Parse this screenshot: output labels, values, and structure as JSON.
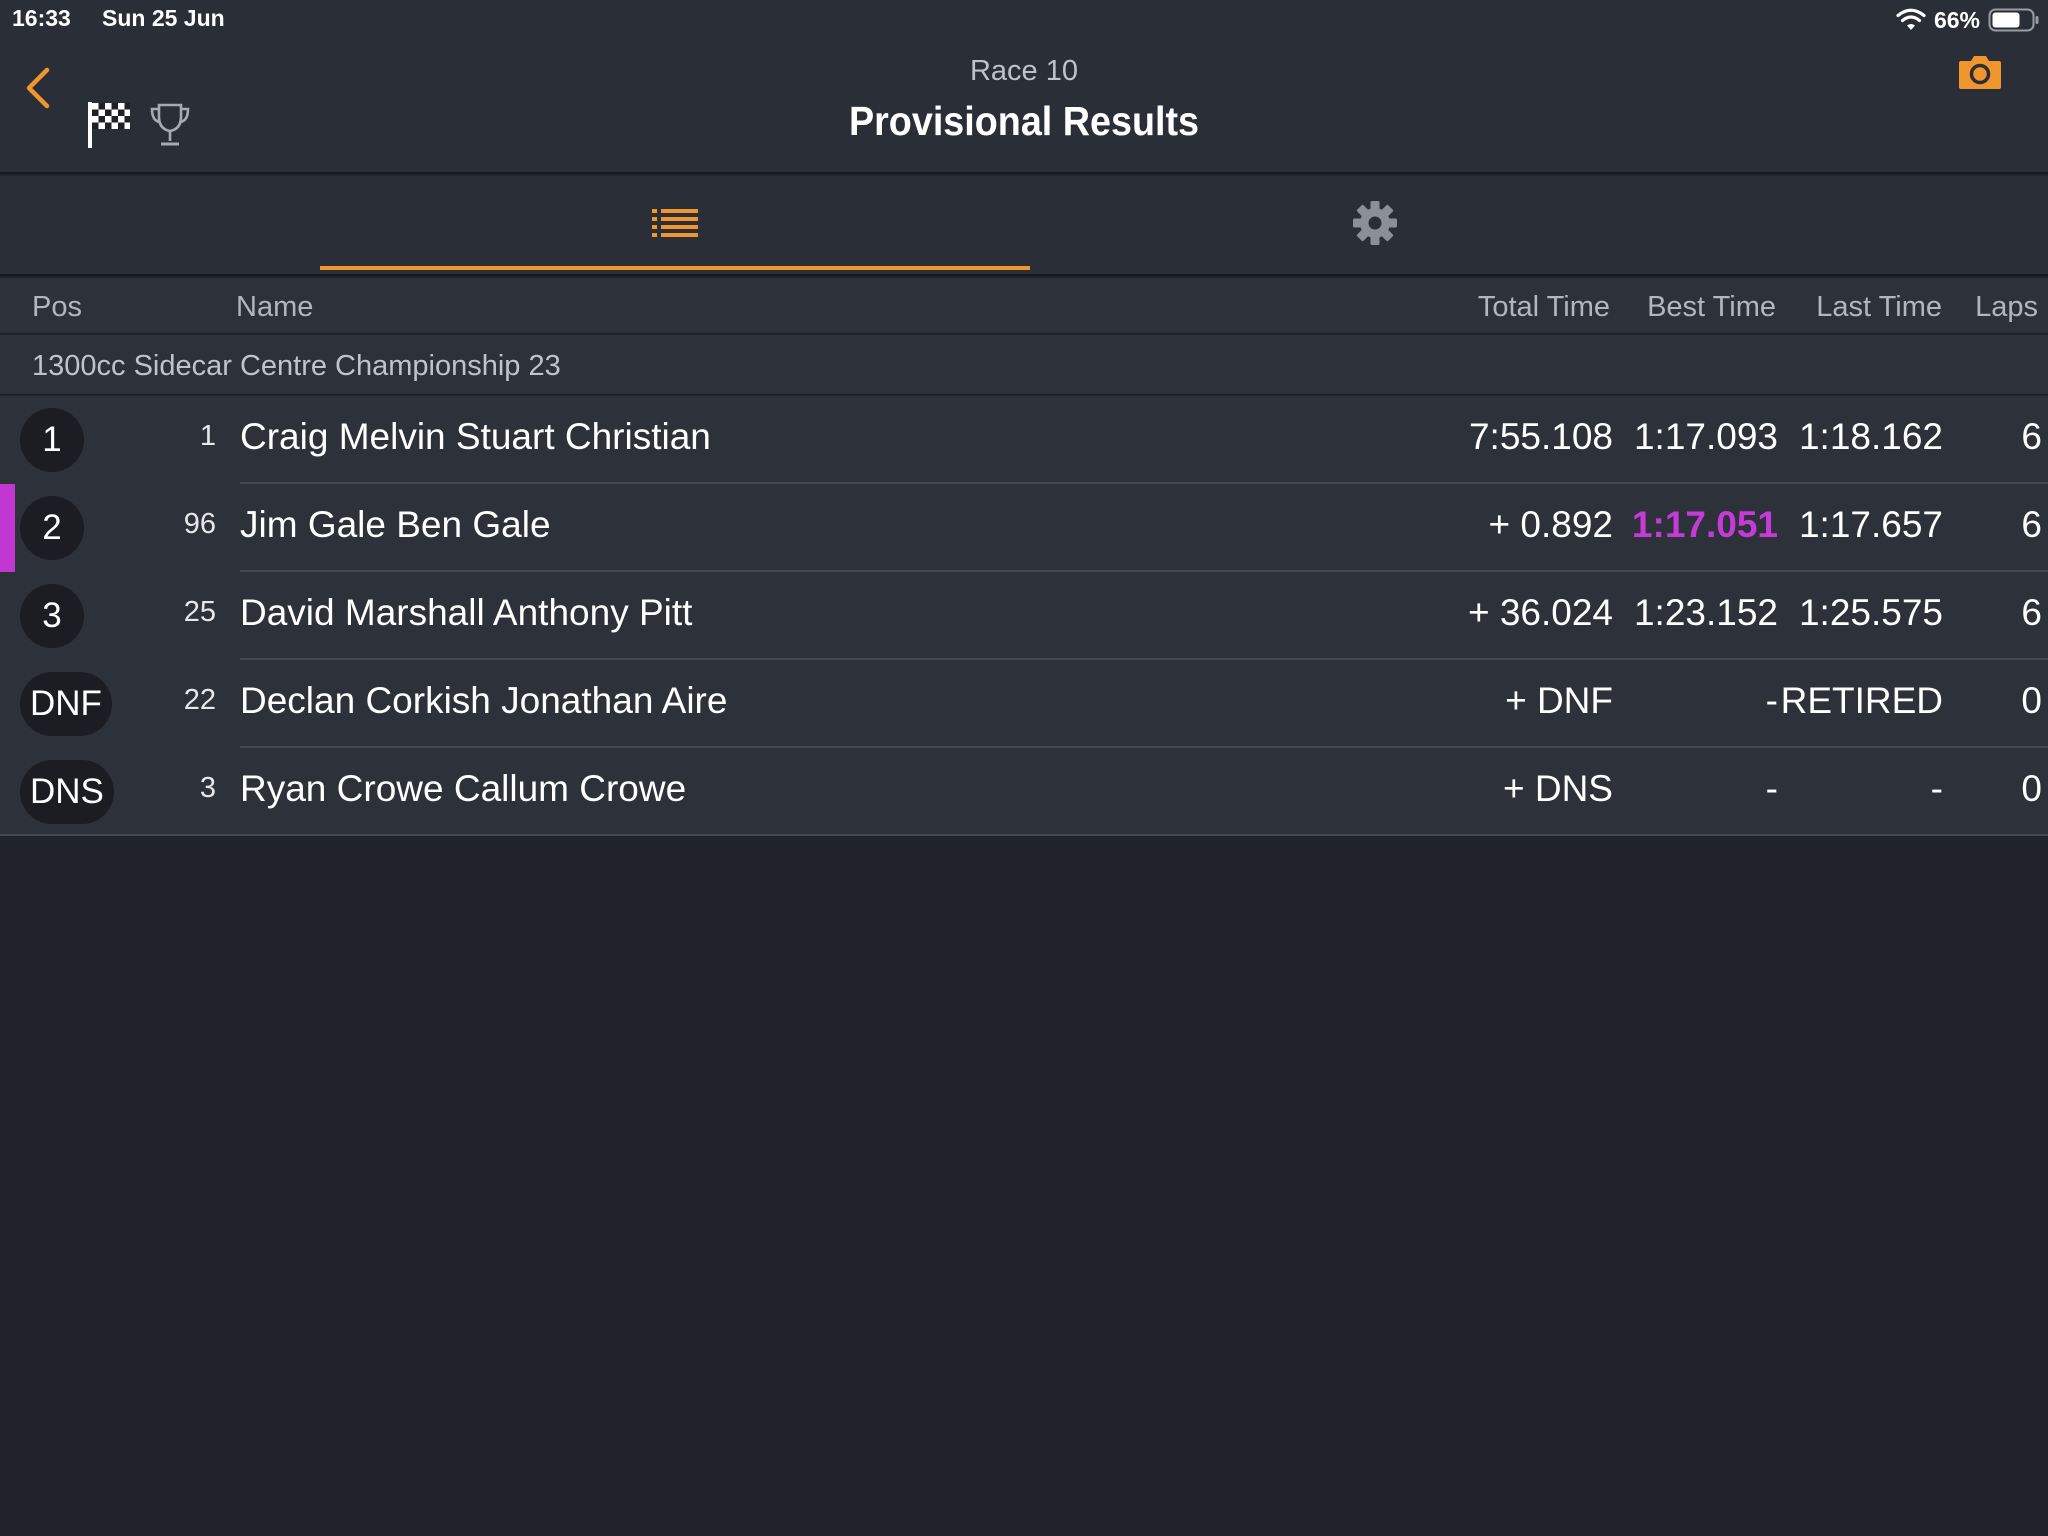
{
  "status_bar": {
    "time": "16:33",
    "date": "Sun 25 Jun",
    "battery_percent": "66%"
  },
  "header": {
    "subtitle": "Race 10",
    "title": "Provisional Results"
  },
  "tabs": [
    {
      "icon": "list-icon",
      "active": true
    },
    {
      "icon": "gear-icon",
      "active": false
    }
  ],
  "columns": {
    "pos": "Pos",
    "name": "Name",
    "total_time": "Total Time",
    "best_time": "Best Time",
    "last_time": "Last Time",
    "laps": "Laps"
  },
  "group": {
    "label": "1300cc Sidecar Centre Championship 23"
  },
  "results": [
    {
      "pos": "1",
      "number": "1",
      "name": "Craig Melvin Stuart Christian",
      "total_time": "7:55.108",
      "best_time": "1:17.093",
      "last_time": "1:18.162",
      "laps": "6"
    },
    {
      "pos": "2",
      "number": "96",
      "name": "Jim Gale Ben Gale",
      "total_time": "+ 0.892",
      "best_time": "1:17.051",
      "last_time": "1:17.657",
      "laps": "6"
    },
    {
      "pos": "3",
      "number": "25",
      "name": "David Marshall Anthony Pitt",
      "total_time": "+ 36.024",
      "best_time": "1:23.152",
      "last_time": "1:25.575",
      "laps": "6"
    },
    {
      "pos": "DNF",
      "number": "22",
      "name": "Declan Corkish Jonathan Aire",
      "total_time": "+ DNF",
      "best_time": "-",
      "last_time": "RETIRED",
      "laps": "0"
    },
    {
      "pos": "DNS",
      "number": "3",
      "name": "Ryan Crowe Callum Crowe",
      "total_time": "+ DNS",
      "best_time": "-",
      "last_time": "-",
      "laps": "0"
    }
  ],
  "colors": {
    "accent": "#f0962e",
    "fastest_lap": "#c63ad6",
    "background": "#20232b",
    "panel": "#2d313a"
  }
}
